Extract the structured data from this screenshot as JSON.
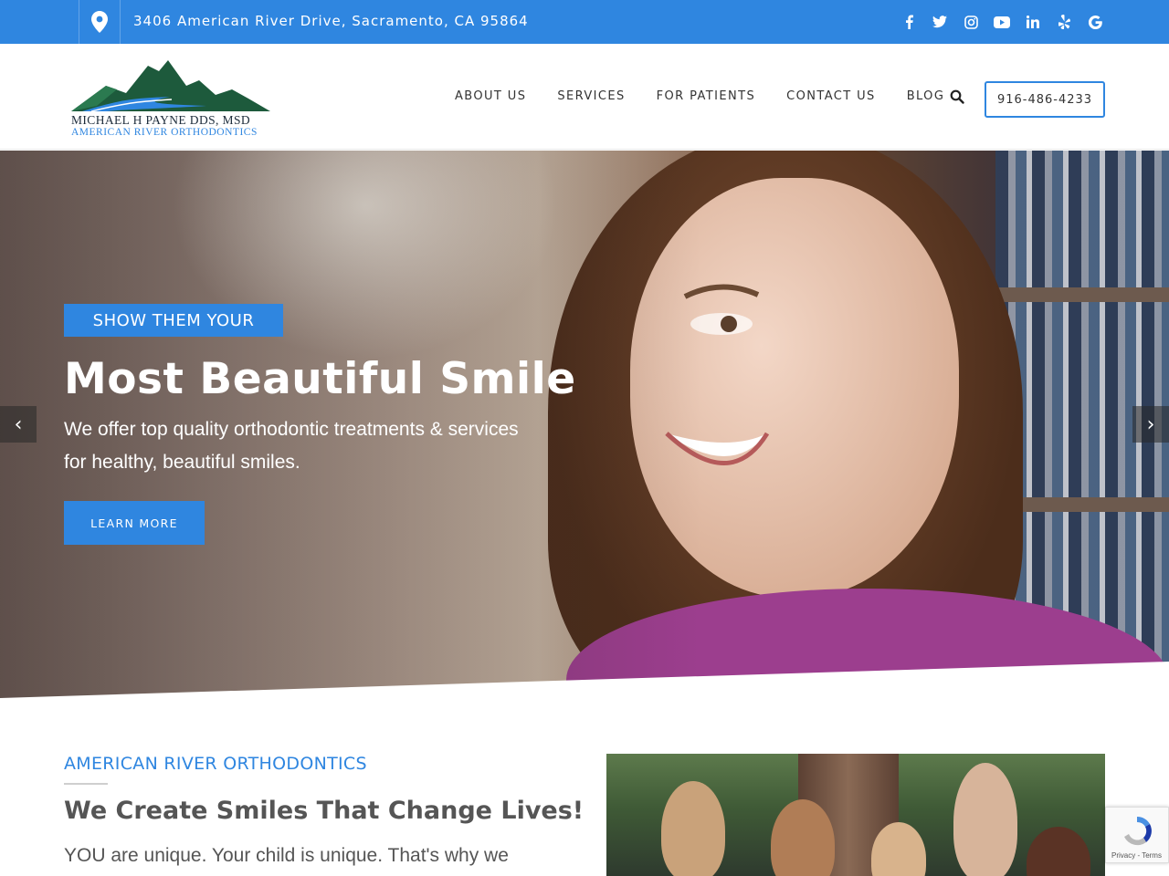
{
  "topbar": {
    "address": "3406 American River Drive, Sacramento, CA 95864",
    "socials": [
      "facebook-icon",
      "twitter-icon",
      "instagram-icon",
      "youtube-icon",
      "linkedin-icon",
      "yelp-icon",
      "google-icon"
    ],
    "accent": "#2f86e0"
  },
  "logo": {
    "line1": "MICHAEL H PAYNE DDS, MSD",
    "line2": "AMERICAN RIVER ORTHODONTICS"
  },
  "nav": {
    "items": [
      {
        "label": "ABOUT US"
      },
      {
        "label": "SERVICES"
      },
      {
        "label": "FOR PATIENTS"
      },
      {
        "label": "CONTACT US"
      },
      {
        "label": "BLOG"
      }
    ],
    "phone": "916-486-4233"
  },
  "hero": {
    "tagline": "SHOW THEM YOUR",
    "title": "Most Beautiful Smile",
    "description": "We offer top quality orthodontic treatments & services for healthy, beautiful smiles.",
    "button": "LEARN MORE",
    "prev": "‹",
    "next": "›"
  },
  "intro": {
    "eyebrow": "AMERICAN RIVER ORTHODONTICS",
    "title": "We Create Smiles That Change Lives!",
    "text": "YOU are unique. Your child is unique. That's why we"
  },
  "recaptcha": {
    "links": "Privacy - Terms"
  }
}
